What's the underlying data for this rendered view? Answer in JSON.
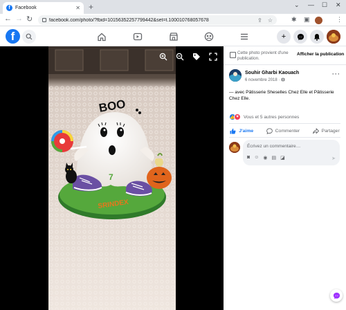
{
  "browser": {
    "tab_title": "Facebook",
    "tab_favicon": "f",
    "url": "facebook.com/photo/?fbid=10156352257799442&set=t.100010768057678"
  },
  "fb_header": {
    "logo": "f",
    "nav_icons": [
      "home-icon",
      "watch-icon",
      "marketplace-icon",
      "groups-icon",
      "menu-icon"
    ],
    "right_buttons": [
      "plus-icon",
      "messenger-icon",
      "notifications-icon",
      "account-avatar"
    ]
  },
  "panel": {
    "notice_text": "Cette photo provient d'une publication.",
    "notice_button": "Afficher la publication",
    "author_name": "Souhir Gharbi Kaouach",
    "post_date": "6 novembre 2018 · ",
    "post_text": "— avec Pâtisserie Sheselles Chez Elle et Pâtisserie Chez Elle.",
    "reactions_text": "Vous et 5 autres personnes",
    "actions": {
      "like": "J'aime",
      "comment": "Commenter",
      "share": "Partager"
    },
    "comment_placeholder": "Écrivez un commentaire…"
  },
  "colors": {
    "fb_blue": "#1877f2",
    "viewer_bg": "#000000",
    "panel_bg": "#ffffff",
    "muted_text": "#65676b"
  }
}
